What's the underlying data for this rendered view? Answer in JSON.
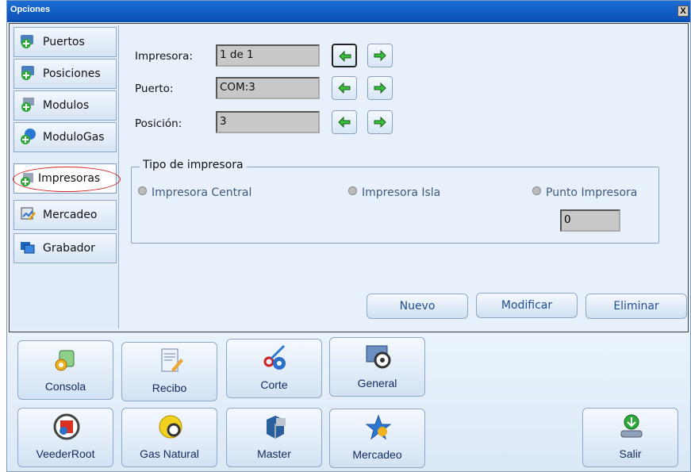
{
  "window": {
    "title": "Opciones",
    "close_label": "X"
  },
  "sidebar": {
    "items": [
      {
        "label": "Puertos",
        "icon": "ports-icon"
      },
      {
        "label": "Posiciones",
        "icon": "positions-icon"
      },
      {
        "label": "Modulos",
        "icon": "modules-icon"
      },
      {
        "label": "ModuloGas",
        "icon": "gas-module-icon"
      },
      {
        "label": "Impresoras",
        "icon": "printer-icon",
        "active": true
      },
      {
        "label": "Mercadeo",
        "icon": "marketing-icon"
      },
      {
        "label": "Grabador",
        "icon": "recorder-icon"
      }
    ]
  },
  "form": {
    "impresora": {
      "label": "Impresora:",
      "value": "1 de 1"
    },
    "puerto": {
      "label": "Puerto:",
      "value": "COM:3"
    },
    "posicion": {
      "label": "Posición:",
      "value": "3"
    }
  },
  "tipo": {
    "legend": "Tipo de impresora",
    "options": [
      "Impresora Central",
      "Impresora Isla",
      "Punto Impresora"
    ],
    "punto_value": "0"
  },
  "actions": {
    "nuevo": "Nuevo",
    "modificar": "Modificar",
    "eliminar": "Eliminar"
  },
  "toolbar": {
    "consola": "Consola",
    "recibo": "Recibo",
    "corte": "Corte",
    "general": "General",
    "veederroot": "VeederRoot",
    "gas_natural": "Gas Natural",
    "master": "Master",
    "mercadeo": "Mercadeo",
    "salir": "Salir"
  },
  "colors": {
    "arrow_green": "#36c23a",
    "title_blue": "#0b4fb5",
    "button_text": "#1f4f8f"
  }
}
